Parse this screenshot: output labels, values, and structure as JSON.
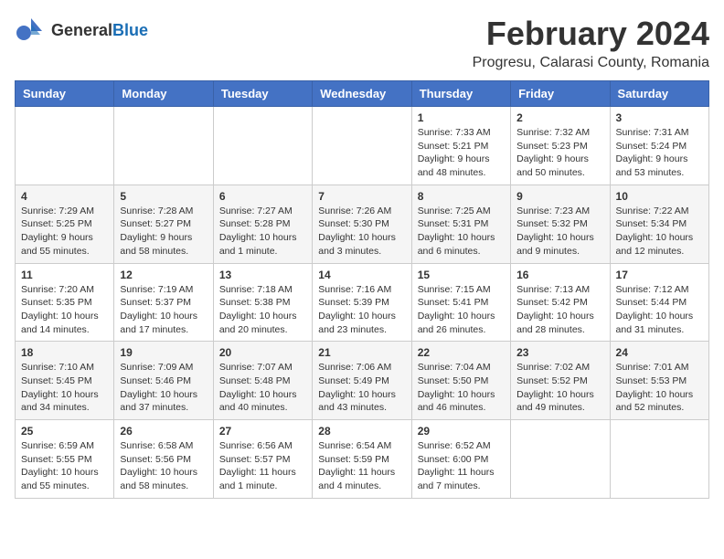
{
  "header": {
    "logo_general": "General",
    "logo_blue": "Blue",
    "month_year": "February 2024",
    "location": "Progresu, Calarasi County, Romania"
  },
  "weekdays": [
    "Sunday",
    "Monday",
    "Tuesday",
    "Wednesday",
    "Thursday",
    "Friday",
    "Saturday"
  ],
  "weeks": [
    [
      {
        "day": "",
        "info": ""
      },
      {
        "day": "",
        "info": ""
      },
      {
        "day": "",
        "info": ""
      },
      {
        "day": "",
        "info": ""
      },
      {
        "day": "1",
        "info": "Sunrise: 7:33 AM\nSunset: 5:21 PM\nDaylight: 9 hours\nand 48 minutes."
      },
      {
        "day": "2",
        "info": "Sunrise: 7:32 AM\nSunset: 5:23 PM\nDaylight: 9 hours\nand 50 minutes."
      },
      {
        "day": "3",
        "info": "Sunrise: 7:31 AM\nSunset: 5:24 PM\nDaylight: 9 hours\nand 53 minutes."
      }
    ],
    [
      {
        "day": "4",
        "info": "Sunrise: 7:29 AM\nSunset: 5:25 PM\nDaylight: 9 hours\nand 55 minutes."
      },
      {
        "day": "5",
        "info": "Sunrise: 7:28 AM\nSunset: 5:27 PM\nDaylight: 9 hours\nand 58 minutes."
      },
      {
        "day": "6",
        "info": "Sunrise: 7:27 AM\nSunset: 5:28 PM\nDaylight: 10 hours\nand 1 minute."
      },
      {
        "day": "7",
        "info": "Sunrise: 7:26 AM\nSunset: 5:30 PM\nDaylight: 10 hours\nand 3 minutes."
      },
      {
        "day": "8",
        "info": "Sunrise: 7:25 AM\nSunset: 5:31 PM\nDaylight: 10 hours\nand 6 minutes."
      },
      {
        "day": "9",
        "info": "Sunrise: 7:23 AM\nSunset: 5:32 PM\nDaylight: 10 hours\nand 9 minutes."
      },
      {
        "day": "10",
        "info": "Sunrise: 7:22 AM\nSunset: 5:34 PM\nDaylight: 10 hours\nand 12 minutes."
      }
    ],
    [
      {
        "day": "11",
        "info": "Sunrise: 7:20 AM\nSunset: 5:35 PM\nDaylight: 10 hours\nand 14 minutes."
      },
      {
        "day": "12",
        "info": "Sunrise: 7:19 AM\nSunset: 5:37 PM\nDaylight: 10 hours\nand 17 minutes."
      },
      {
        "day": "13",
        "info": "Sunrise: 7:18 AM\nSunset: 5:38 PM\nDaylight: 10 hours\nand 20 minutes."
      },
      {
        "day": "14",
        "info": "Sunrise: 7:16 AM\nSunset: 5:39 PM\nDaylight: 10 hours\nand 23 minutes."
      },
      {
        "day": "15",
        "info": "Sunrise: 7:15 AM\nSunset: 5:41 PM\nDaylight: 10 hours\nand 26 minutes."
      },
      {
        "day": "16",
        "info": "Sunrise: 7:13 AM\nSunset: 5:42 PM\nDaylight: 10 hours\nand 28 minutes."
      },
      {
        "day": "17",
        "info": "Sunrise: 7:12 AM\nSunset: 5:44 PM\nDaylight: 10 hours\nand 31 minutes."
      }
    ],
    [
      {
        "day": "18",
        "info": "Sunrise: 7:10 AM\nSunset: 5:45 PM\nDaylight: 10 hours\nand 34 minutes."
      },
      {
        "day": "19",
        "info": "Sunrise: 7:09 AM\nSunset: 5:46 PM\nDaylight: 10 hours\nand 37 minutes."
      },
      {
        "day": "20",
        "info": "Sunrise: 7:07 AM\nSunset: 5:48 PM\nDaylight: 10 hours\nand 40 minutes."
      },
      {
        "day": "21",
        "info": "Sunrise: 7:06 AM\nSunset: 5:49 PM\nDaylight: 10 hours\nand 43 minutes."
      },
      {
        "day": "22",
        "info": "Sunrise: 7:04 AM\nSunset: 5:50 PM\nDaylight: 10 hours\nand 46 minutes."
      },
      {
        "day": "23",
        "info": "Sunrise: 7:02 AM\nSunset: 5:52 PM\nDaylight: 10 hours\nand 49 minutes."
      },
      {
        "day": "24",
        "info": "Sunrise: 7:01 AM\nSunset: 5:53 PM\nDaylight: 10 hours\nand 52 minutes."
      }
    ],
    [
      {
        "day": "25",
        "info": "Sunrise: 6:59 AM\nSunset: 5:55 PM\nDaylight: 10 hours\nand 55 minutes."
      },
      {
        "day": "26",
        "info": "Sunrise: 6:58 AM\nSunset: 5:56 PM\nDaylight: 10 hours\nand 58 minutes."
      },
      {
        "day": "27",
        "info": "Sunrise: 6:56 AM\nSunset: 5:57 PM\nDaylight: 11 hours\nand 1 minute."
      },
      {
        "day": "28",
        "info": "Sunrise: 6:54 AM\nSunset: 5:59 PM\nDaylight: 11 hours\nand 4 minutes."
      },
      {
        "day": "29",
        "info": "Sunrise: 6:52 AM\nSunset: 6:00 PM\nDaylight: 11 hours\nand 7 minutes."
      },
      {
        "day": "",
        "info": ""
      },
      {
        "day": "",
        "info": ""
      }
    ]
  ]
}
